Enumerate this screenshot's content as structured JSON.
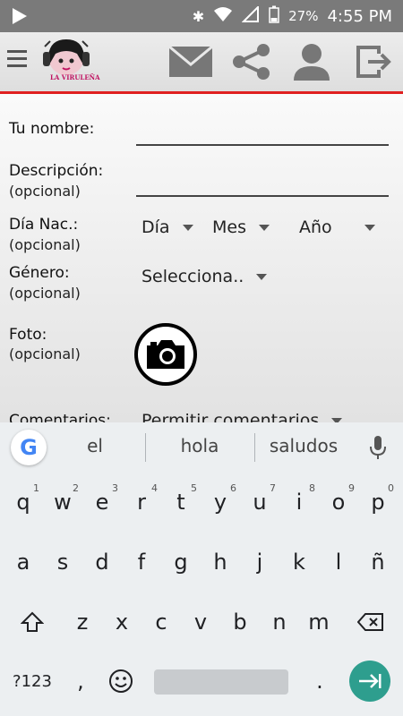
{
  "status_bar": {
    "battery": "27%",
    "time": "4:55 PM"
  },
  "app_bar": {
    "logo_text": "LA VIRULEÑA"
  },
  "form": {
    "name_label": "Tu nombre:",
    "desc_label": "Descripción:",
    "desc_sub": "(opcional)",
    "birth_label": "Día Nac.:",
    "birth_sub": "(opcional)",
    "day": "Día",
    "month": "Mes",
    "year": "Año",
    "gender_label": "Género:",
    "gender_sub": "(opcional)",
    "gender_value": "Selecciona..",
    "photo_label": "Foto:",
    "photo_sub": "(opcional)",
    "comments_label": "Comentarios:",
    "comments_value": "Permitir comentarios"
  },
  "keyboard": {
    "google": "G",
    "suggestions": [
      "el",
      "hola",
      "saludos"
    ],
    "row1": [
      {
        "k": "q",
        "h": "1"
      },
      {
        "k": "w",
        "h": "2"
      },
      {
        "k": "e",
        "h": "3"
      },
      {
        "k": "r",
        "h": "4"
      },
      {
        "k": "t",
        "h": "5"
      },
      {
        "k": "y",
        "h": "6"
      },
      {
        "k": "u",
        "h": "7"
      },
      {
        "k": "i",
        "h": "8"
      },
      {
        "k": "o",
        "h": "9"
      },
      {
        "k": "p",
        "h": "0"
      }
    ],
    "row2": [
      "a",
      "s",
      "d",
      "f",
      "g",
      "h",
      "j",
      "k",
      "l",
      "ñ"
    ],
    "row3": [
      "z",
      "x",
      "c",
      "v",
      "b",
      "n",
      "m"
    ],
    "symbols": "?123",
    "comma": ",",
    "period": "."
  }
}
